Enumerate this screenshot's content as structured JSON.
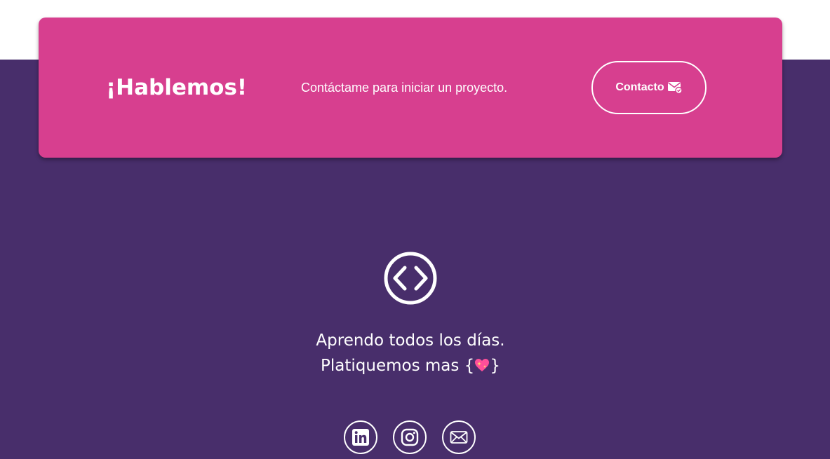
{
  "cta": {
    "title": "¡Hablemos!",
    "text": "Contáctame para iniciar un proyecto.",
    "button_label": "Contacto",
    "button_icon": "mail-check-icon"
  },
  "footer": {
    "logo_icon": "code-brackets-icon",
    "tagline_line1": "Aprendo todos los días.",
    "tagline_line2_prefix": "Platiquemos mas {",
    "tagline_line2_emoji": "sparkling-heart-emoji",
    "tagline_line2_suffix": "}",
    "social": [
      {
        "name": "linkedin-icon"
      },
      {
        "name": "instagram-icon"
      },
      {
        "name": "email-icon"
      }
    ]
  },
  "colors": {
    "background": "#482e6b",
    "card": "#d73f8f",
    "text": "#ffffff"
  }
}
